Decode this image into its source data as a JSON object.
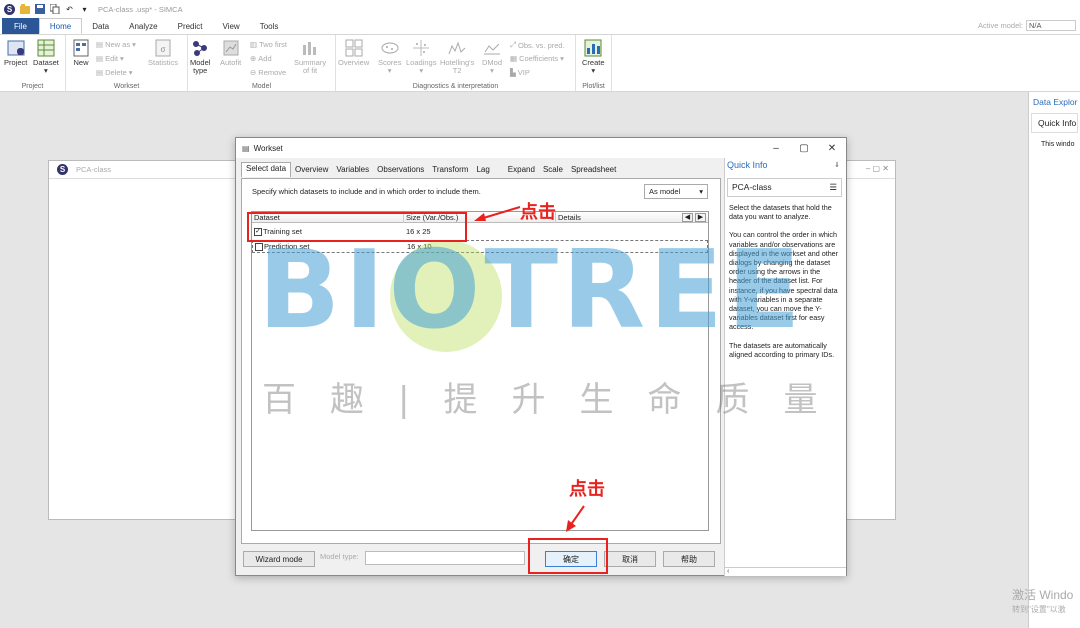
{
  "app": {
    "title": "PCA-class .usp* - SIMCA",
    "active_model_label": "Active model:",
    "active_model_value": "N/A"
  },
  "menu": {
    "tabs": [
      "File",
      "Home",
      "Data",
      "Analyze",
      "Predict",
      "View",
      "Tools"
    ]
  },
  "ribbon": {
    "project": {
      "label": "Project",
      "project_btn": "Project",
      "dataset_btn": "Dataset"
    },
    "workset": {
      "label": "Workset",
      "new_btn": "New",
      "new_as": "New as",
      "edit": "Edit",
      "delete": "Delete",
      "statistics": "Statistics"
    },
    "model": {
      "label": "Model",
      "model_type": "Model",
      "model_type2": "type",
      "autofit": "Autofit",
      "two_first": "Two first",
      "add": "Add",
      "remove": "Remove",
      "summary": "Summary",
      "summary2": "of fit"
    },
    "diagnostics": {
      "label": "Diagnostics & interpretation",
      "overview": "Overview",
      "scores": "Scores",
      "loadings": "Loadings",
      "hotelling": "Hotelling's",
      "hotelling2": "T2",
      "dmod": "DMod",
      "obs_vs_pred": "Obs. vs. pred.",
      "coefficients": "Coefficients",
      "vip": "VIP"
    },
    "plotlist": {
      "label": "Plot/list",
      "create": "Create"
    }
  },
  "background": {
    "doc_title": "PCA-class",
    "data_explorer": "Data Explor",
    "quick_info": "Quick Info",
    "this_window": "This windo"
  },
  "watermark": {
    "text": "BIOTREE",
    "chinese": "百趣|提升生命质量"
  },
  "dialog": {
    "title": "Workset",
    "tabs": [
      "Select data",
      "Overview",
      "Variables",
      "Observations",
      "Transform",
      "Lag",
      "Expand",
      "Scale",
      "Spreadsheet"
    ],
    "instruction": "Specify which datasets to include and in which order to include them.",
    "order_select": "As model",
    "table": {
      "col_dataset": "Dataset",
      "col_size": "Size (Var./Obs.)",
      "col_details": "Details",
      "rows": [
        {
          "name": "Training set",
          "size": "16 x 25",
          "checked": true
        },
        {
          "name": "Prediction set",
          "size": "16 x 10",
          "checked": false
        }
      ]
    },
    "quick_info": {
      "title": "Quick Info",
      "subtitle": "PCA-class",
      "p1": "Select the datasets that hold the data you want to analyze.",
      "p2": "You can control the order in which variables and/or observations are displayed in the workset and other dialogs by changing the dataset order using the arrows in the header of the dataset list. For instance, if you have spectral data with Y-variables in a separate dataset, you can move the Y-variables dataset first for easy access.",
      "p3": "The datasets are automatically aligned according to primary IDs."
    },
    "buttons": {
      "wizard": "Wizard mode",
      "model_type_label": "Model type:",
      "ok": "确定",
      "cancel": "取消",
      "help": "帮助"
    }
  },
  "annotations": {
    "click1": "点击",
    "click2": "点击"
  },
  "windows": {
    "activate": "激活 Windo",
    "activate_sub": "转到\"设置\"以激"
  },
  "colors": {
    "accent": "#2b5797",
    "annotation": "#e8221e",
    "link": "#2b6cb8"
  }
}
